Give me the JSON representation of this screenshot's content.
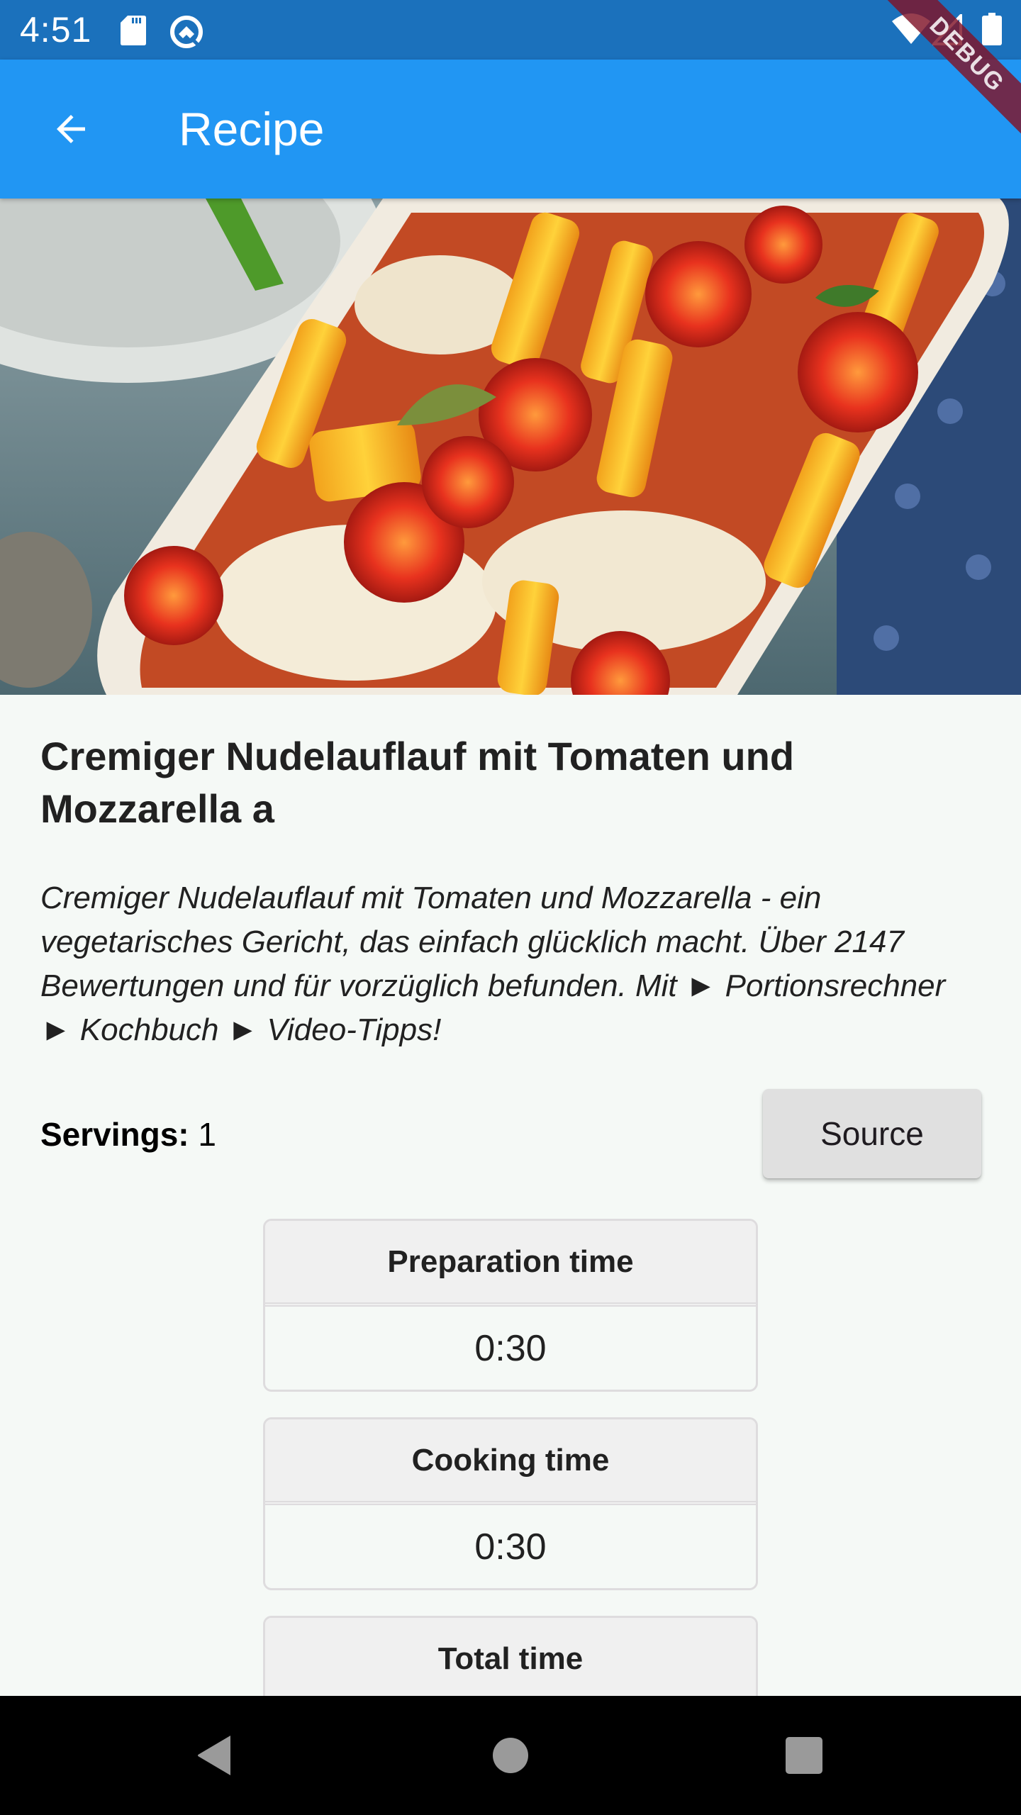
{
  "status_bar": {
    "time": "4:51",
    "icons": [
      "sd-card-icon",
      "android-q-icon",
      "wifi-icon",
      "cell-signal-icon",
      "battery-icon"
    ]
  },
  "debug_banner": {
    "label": "DEBUG"
  },
  "app_bar": {
    "back_icon": "arrow-back-icon",
    "title": "Recipe",
    "color": "#2196f3"
  },
  "hero_image": {
    "alt": "Cremiger Nudelauflauf mit Tomaten und Mozzarella"
  },
  "recipe": {
    "title": "Cremiger Nudelauflauf mit Tomaten und Mozzarella a",
    "description": "Cremiger Nudelauflauf mit Tomaten und Mozzarella - ein vegetarisches Gericht, das einfach glücklich macht. Über 2147 Bewertungen und für vorzüglich befunden. Mit ► Portionsrechner ► Kochbuch ► Video-Tipps!",
    "servings_label": "Servings:",
    "servings_value": "1",
    "source_button": "Source"
  },
  "times": [
    {
      "label": "Preparation time",
      "value": "0:30"
    },
    {
      "label": "Cooking time",
      "value": "0:30"
    },
    {
      "label": "Total time",
      "value": ""
    }
  ],
  "nav_bar": {
    "buttons": [
      "nav-back-icon",
      "nav-home-icon",
      "nav-recents-icon"
    ]
  }
}
